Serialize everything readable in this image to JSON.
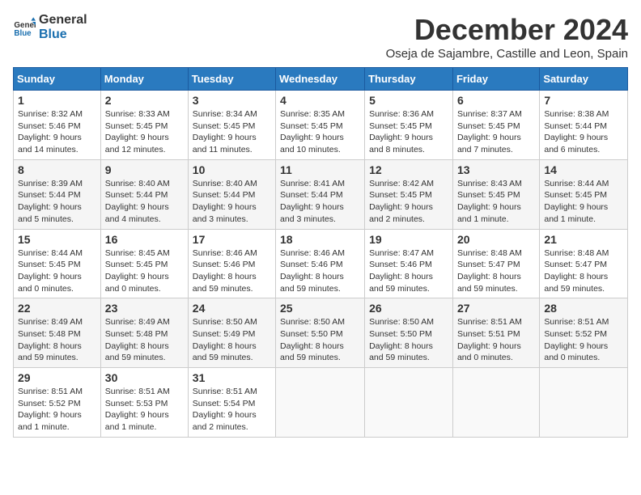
{
  "header": {
    "logo_general": "General",
    "logo_blue": "Blue",
    "title": "December 2024",
    "subtitle": "Oseja de Sajambre, Castille and Leon, Spain"
  },
  "weekdays": [
    "Sunday",
    "Monday",
    "Tuesday",
    "Wednesday",
    "Thursday",
    "Friday",
    "Saturday"
  ],
  "weeks": [
    [
      {
        "day": "1",
        "sunrise": "Sunrise: 8:32 AM",
        "sunset": "Sunset: 5:46 PM",
        "daylight": "Daylight: 9 hours and 14 minutes."
      },
      {
        "day": "2",
        "sunrise": "Sunrise: 8:33 AM",
        "sunset": "Sunset: 5:45 PM",
        "daylight": "Daylight: 9 hours and 12 minutes."
      },
      {
        "day": "3",
        "sunrise": "Sunrise: 8:34 AM",
        "sunset": "Sunset: 5:45 PM",
        "daylight": "Daylight: 9 hours and 11 minutes."
      },
      {
        "day": "4",
        "sunrise": "Sunrise: 8:35 AM",
        "sunset": "Sunset: 5:45 PM",
        "daylight": "Daylight: 9 hours and 10 minutes."
      },
      {
        "day": "5",
        "sunrise": "Sunrise: 8:36 AM",
        "sunset": "Sunset: 5:45 PM",
        "daylight": "Daylight: 9 hours and 8 minutes."
      },
      {
        "day": "6",
        "sunrise": "Sunrise: 8:37 AM",
        "sunset": "Sunset: 5:45 PM",
        "daylight": "Daylight: 9 hours and 7 minutes."
      },
      {
        "day": "7",
        "sunrise": "Sunrise: 8:38 AM",
        "sunset": "Sunset: 5:44 PM",
        "daylight": "Daylight: 9 hours and 6 minutes."
      }
    ],
    [
      {
        "day": "8",
        "sunrise": "Sunrise: 8:39 AM",
        "sunset": "Sunset: 5:44 PM",
        "daylight": "Daylight: 9 hours and 5 minutes."
      },
      {
        "day": "9",
        "sunrise": "Sunrise: 8:40 AM",
        "sunset": "Sunset: 5:44 PM",
        "daylight": "Daylight: 9 hours and 4 minutes."
      },
      {
        "day": "10",
        "sunrise": "Sunrise: 8:40 AM",
        "sunset": "Sunset: 5:44 PM",
        "daylight": "Daylight: 9 hours and 3 minutes."
      },
      {
        "day": "11",
        "sunrise": "Sunrise: 8:41 AM",
        "sunset": "Sunset: 5:44 PM",
        "daylight": "Daylight: 9 hours and 3 minutes."
      },
      {
        "day": "12",
        "sunrise": "Sunrise: 8:42 AM",
        "sunset": "Sunset: 5:45 PM",
        "daylight": "Daylight: 9 hours and 2 minutes."
      },
      {
        "day": "13",
        "sunrise": "Sunrise: 8:43 AM",
        "sunset": "Sunset: 5:45 PM",
        "daylight": "Daylight: 9 hours and 1 minute."
      },
      {
        "day": "14",
        "sunrise": "Sunrise: 8:44 AM",
        "sunset": "Sunset: 5:45 PM",
        "daylight": "Daylight: 9 hours and 1 minute."
      }
    ],
    [
      {
        "day": "15",
        "sunrise": "Sunrise: 8:44 AM",
        "sunset": "Sunset: 5:45 PM",
        "daylight": "Daylight: 9 hours and 0 minutes."
      },
      {
        "day": "16",
        "sunrise": "Sunrise: 8:45 AM",
        "sunset": "Sunset: 5:45 PM",
        "daylight": "Daylight: 9 hours and 0 minutes."
      },
      {
        "day": "17",
        "sunrise": "Sunrise: 8:46 AM",
        "sunset": "Sunset: 5:46 PM",
        "daylight": "Daylight: 8 hours and 59 minutes."
      },
      {
        "day": "18",
        "sunrise": "Sunrise: 8:46 AM",
        "sunset": "Sunset: 5:46 PM",
        "daylight": "Daylight: 8 hours and 59 minutes."
      },
      {
        "day": "19",
        "sunrise": "Sunrise: 8:47 AM",
        "sunset": "Sunset: 5:46 PM",
        "daylight": "Daylight: 8 hours and 59 minutes."
      },
      {
        "day": "20",
        "sunrise": "Sunrise: 8:48 AM",
        "sunset": "Sunset: 5:47 PM",
        "daylight": "Daylight: 8 hours and 59 minutes."
      },
      {
        "day": "21",
        "sunrise": "Sunrise: 8:48 AM",
        "sunset": "Sunset: 5:47 PM",
        "daylight": "Daylight: 8 hours and 59 minutes."
      }
    ],
    [
      {
        "day": "22",
        "sunrise": "Sunrise: 8:49 AM",
        "sunset": "Sunset: 5:48 PM",
        "daylight": "Daylight: 8 hours and 59 minutes."
      },
      {
        "day": "23",
        "sunrise": "Sunrise: 8:49 AM",
        "sunset": "Sunset: 5:48 PM",
        "daylight": "Daylight: 8 hours and 59 minutes."
      },
      {
        "day": "24",
        "sunrise": "Sunrise: 8:50 AM",
        "sunset": "Sunset: 5:49 PM",
        "daylight": "Daylight: 8 hours and 59 minutes."
      },
      {
        "day": "25",
        "sunrise": "Sunrise: 8:50 AM",
        "sunset": "Sunset: 5:50 PM",
        "daylight": "Daylight: 8 hours and 59 minutes."
      },
      {
        "day": "26",
        "sunrise": "Sunrise: 8:50 AM",
        "sunset": "Sunset: 5:50 PM",
        "daylight": "Daylight: 8 hours and 59 minutes."
      },
      {
        "day": "27",
        "sunrise": "Sunrise: 8:51 AM",
        "sunset": "Sunset: 5:51 PM",
        "daylight": "Daylight: 9 hours and 0 minutes."
      },
      {
        "day": "28",
        "sunrise": "Sunrise: 8:51 AM",
        "sunset": "Sunset: 5:52 PM",
        "daylight": "Daylight: 9 hours and 0 minutes."
      }
    ],
    [
      {
        "day": "29",
        "sunrise": "Sunrise: 8:51 AM",
        "sunset": "Sunset: 5:52 PM",
        "daylight": "Daylight: 9 hours and 1 minute."
      },
      {
        "day": "30",
        "sunrise": "Sunrise: 8:51 AM",
        "sunset": "Sunset: 5:53 PM",
        "daylight": "Daylight: 9 hours and 1 minute."
      },
      {
        "day": "31",
        "sunrise": "Sunrise: 8:51 AM",
        "sunset": "Sunset: 5:54 PM",
        "daylight": "Daylight: 9 hours and 2 minutes."
      },
      null,
      null,
      null,
      null
    ]
  ]
}
